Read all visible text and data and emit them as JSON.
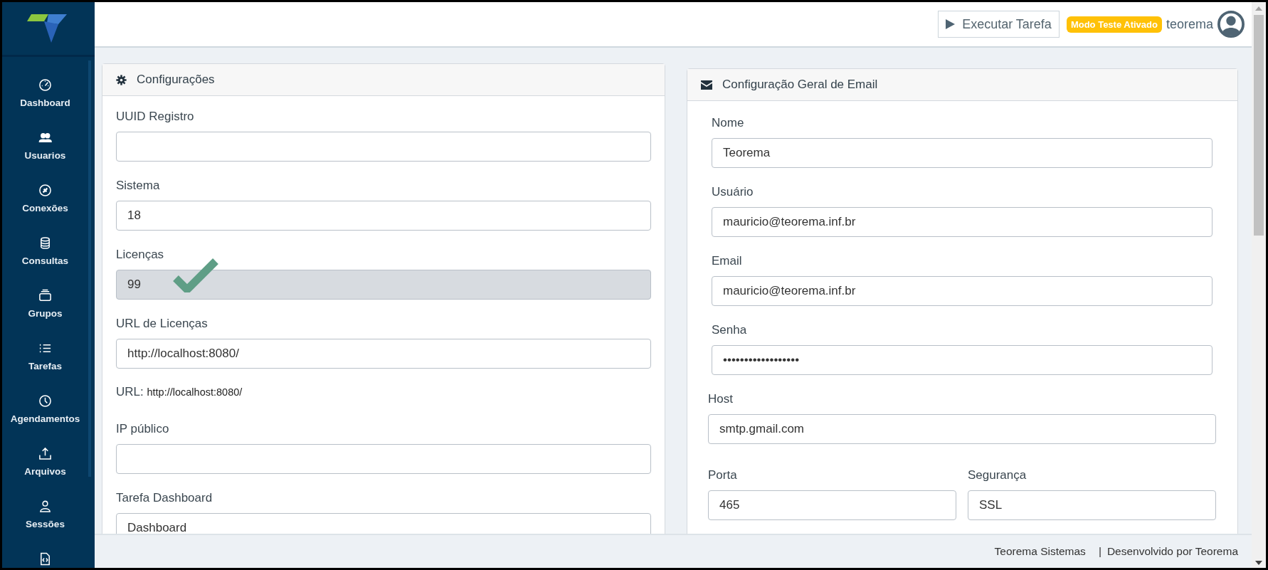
{
  "header": {
    "run_button": "Executar Tarefa",
    "badge": "Modo Teste Ativado",
    "user": "teorema"
  },
  "sidebar": {
    "items": [
      {
        "kind": "gauge",
        "label": "Dashboard"
      },
      {
        "kind": "users",
        "label": "Usuarios"
      },
      {
        "kind": "plug",
        "label": "Conexões"
      },
      {
        "kind": "database",
        "label": "Consultas"
      },
      {
        "kind": "layers",
        "label": "Grupos"
      },
      {
        "kind": "list",
        "label": "Tarefas"
      },
      {
        "kind": "clock",
        "label": "Agendamentos"
      },
      {
        "kind": "upload",
        "label": "Arquivos"
      },
      {
        "kind": "person",
        "label": "Sessões"
      },
      {
        "kind": "file"
      }
    ]
  },
  "settings_panel": {
    "title": "Configurações",
    "items": [
      {
        "kind": "field",
        "label": "UUID Registro",
        "disabled": false
      },
      {
        "kind": "field",
        "label": "Sistema",
        "value": "18",
        "disabled": false
      },
      {
        "kind": "field",
        "label": "Licenças",
        "value": "99",
        "disabled": true,
        "verified": true
      },
      {
        "kind": "field",
        "label": "URL de Licenças",
        "value": "http://localhost:8080/",
        "disabled": false
      },
      {
        "kind": "note",
        "label": "URL:",
        "value": "http://localhost:8080/"
      },
      {
        "kind": "field",
        "label": "IP público",
        "disabled": false
      },
      {
        "kind": "field",
        "label": "Tarefa Dashboard",
        "value": "Dashboard",
        "disabled": false
      }
    ]
  },
  "email_panel": {
    "title": "Configuração Geral de Email",
    "fields": [
      {
        "label": "Nome",
        "value": "Teorema"
      },
      {
        "label": "Usuário",
        "value": "mauricio@teorema.inf.br"
      },
      {
        "label": "Email",
        "value": "mauricio@teorema.inf.br"
      },
      {
        "label": "Senha",
        "value": "••••••••••••••••••"
      }
    ],
    "server": {
      "host": {
        "label": "Host",
        "value": "smtp.gmail.com"
      },
      "port": {
        "label": "Porta",
        "value": "465"
      },
      "security": {
        "label": "Segurança",
        "value": "SSL"
      }
    }
  },
  "footer": {
    "company": "Teorema Sistemas",
    "separator": "|",
    "credit": "Desenvolvido por Teorema"
  }
}
